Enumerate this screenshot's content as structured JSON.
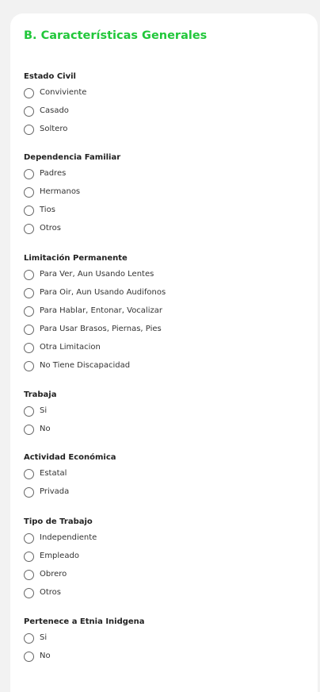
{
  "section": {
    "title": "B. Características Generales"
  },
  "groups": [
    {
      "label": "Estado Civil",
      "options": [
        "Conviviente",
        "Casado",
        "Soltero"
      ]
    },
    {
      "label": "Dependencia Familiar",
      "options": [
        "Padres",
        "Hermanos",
        "Tios",
        "Otros"
      ]
    },
    {
      "label": "Limitación Permanente",
      "options": [
        "Para Ver, Aun Usando Lentes",
        "Para Oir, Aun Usando Audifonos",
        "Para Hablar, Entonar, Vocalizar",
        "Para Usar Brasos, Piernas, Pies",
        "Otra Limitacion",
        "No Tiene Discapacidad"
      ]
    },
    {
      "label": "Trabaja",
      "options": [
        "Si",
        "No"
      ]
    },
    {
      "label": "Actividad Económica",
      "options": [
        "Estatal",
        "Privada"
      ]
    },
    {
      "label": "Tipo de Trabajo",
      "options": [
        "Independiente",
        "Empleado",
        "Obrero",
        "Otros"
      ]
    },
    {
      "label": "Pertenece a Etnia Inidgena",
      "options": [
        "Si",
        "No"
      ]
    }
  ]
}
